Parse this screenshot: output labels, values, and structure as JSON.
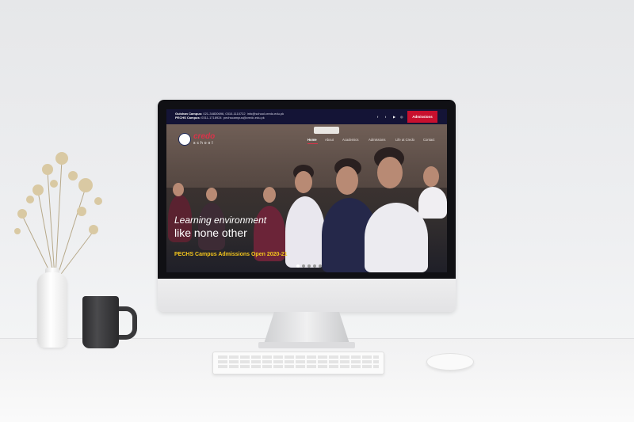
{
  "topbar": {
    "gulshan_label": "Gulshan Campus:",
    "gulshan_phones": "021-34830696, 0310-1110722",
    "gulshan_email": "info@school.credo.edu.pk",
    "pechs_label": "PECHS Campus:",
    "pechs_phones": "0311-1718924",
    "pechs_email": "pechscampus@credo.edu.pk",
    "social_icons": [
      "facebook-icon",
      "twitter-icon",
      "youtube-icon",
      "instagram-icon"
    ],
    "social_glyphs": [
      "f",
      "t",
      "▶",
      "◎"
    ],
    "admissions_button": "Admissions"
  },
  "logo": {
    "word1": "credo",
    "word2": "school"
  },
  "nav": {
    "items": [
      "Home",
      "About",
      "Academics",
      "Admissions",
      "Life at Credo",
      "Contact"
    ],
    "active": "Home"
  },
  "hero": {
    "headline_line1": "Learning environment",
    "headline_line2": "like none other",
    "announcement": "PECHS Campus Admissions Open 2020-21",
    "slider_dots": 5,
    "active_dot": 0
  },
  "colors": {
    "topbar": "#141436",
    "accent_red": "#c8102e",
    "announcement_yellow": "#f4c61c"
  }
}
